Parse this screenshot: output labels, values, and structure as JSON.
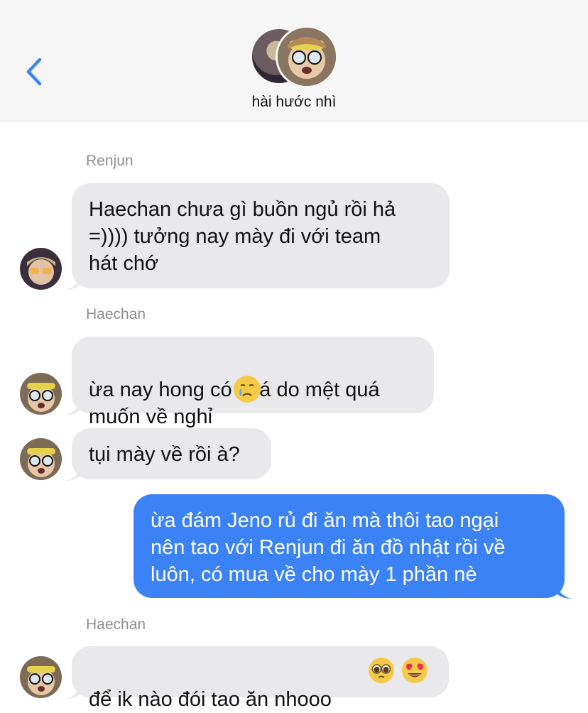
{
  "header": {
    "title": "hài hước nhì",
    "back_icon": "chevron-left-icon",
    "accent": "#3b82f6"
  },
  "messages": [
    {
      "sender": "Renjun",
      "text": "Haechan chưa gì buồn ngủ rồi hả\n=)))) tưởng nay mày đi với team\nhát chớ"
    },
    {
      "sender": "Haechan",
      "text": "ừa nay hong có đi á do mệt quá\nmuốn về nghỉ",
      "emoji": "crying-face"
    },
    {
      "text": "tụi mày về rồi à?"
    },
    {
      "text": "ừa đám Jeno rủ đi ăn mà thôi tao ngại\nnên tao với Renjun đi ăn đồ nhật rồi về\nluôn, có mua về cho mày 1 phần nè",
      "outgoing": true
    },
    {
      "sender": "Haechan",
      "text": "để ik nào đói tao ăn nhooo",
      "emojis": [
        "pleading-face",
        "heart-eyes-face"
      ]
    }
  ],
  "colors": {
    "incoming_bubble": "#e9e9eb",
    "outgoing_bubble": "#3b82f6",
    "sender_label": "#8e8e93"
  }
}
